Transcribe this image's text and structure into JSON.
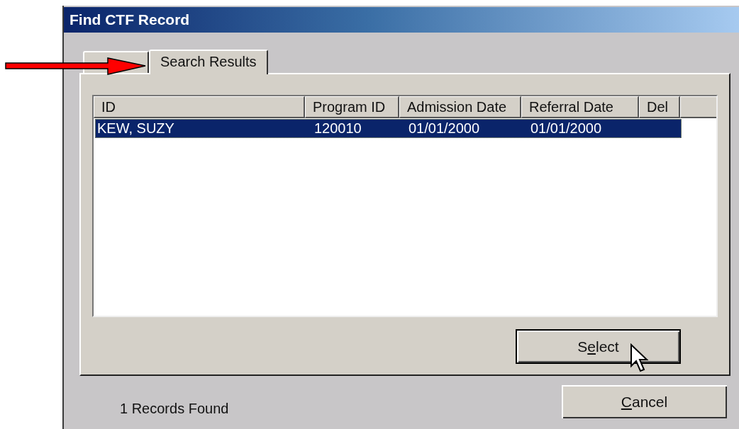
{
  "window": {
    "title": "Find CTF Record"
  },
  "tabs": [
    {
      "selected": false
    },
    {
      "label": "Search Results",
      "selected": true
    }
  ],
  "table": {
    "columns": [
      "ID",
      "Program ID",
      "Admission Date",
      "Referral Date",
      "Del"
    ],
    "rows": [
      {
        "cells": [
          "KEW, SUZY",
          "120010",
          "01/01/2000",
          "01/01/2000"
        ],
        "selected": true
      }
    ]
  },
  "select_button": {
    "before": "S",
    "mnemonic": "e",
    "after": "lect",
    "default": true
  },
  "status": "1 Records Found",
  "cancel_button": {
    "mnemonic": "C",
    "after": "ancel",
    "default": false
  }
}
